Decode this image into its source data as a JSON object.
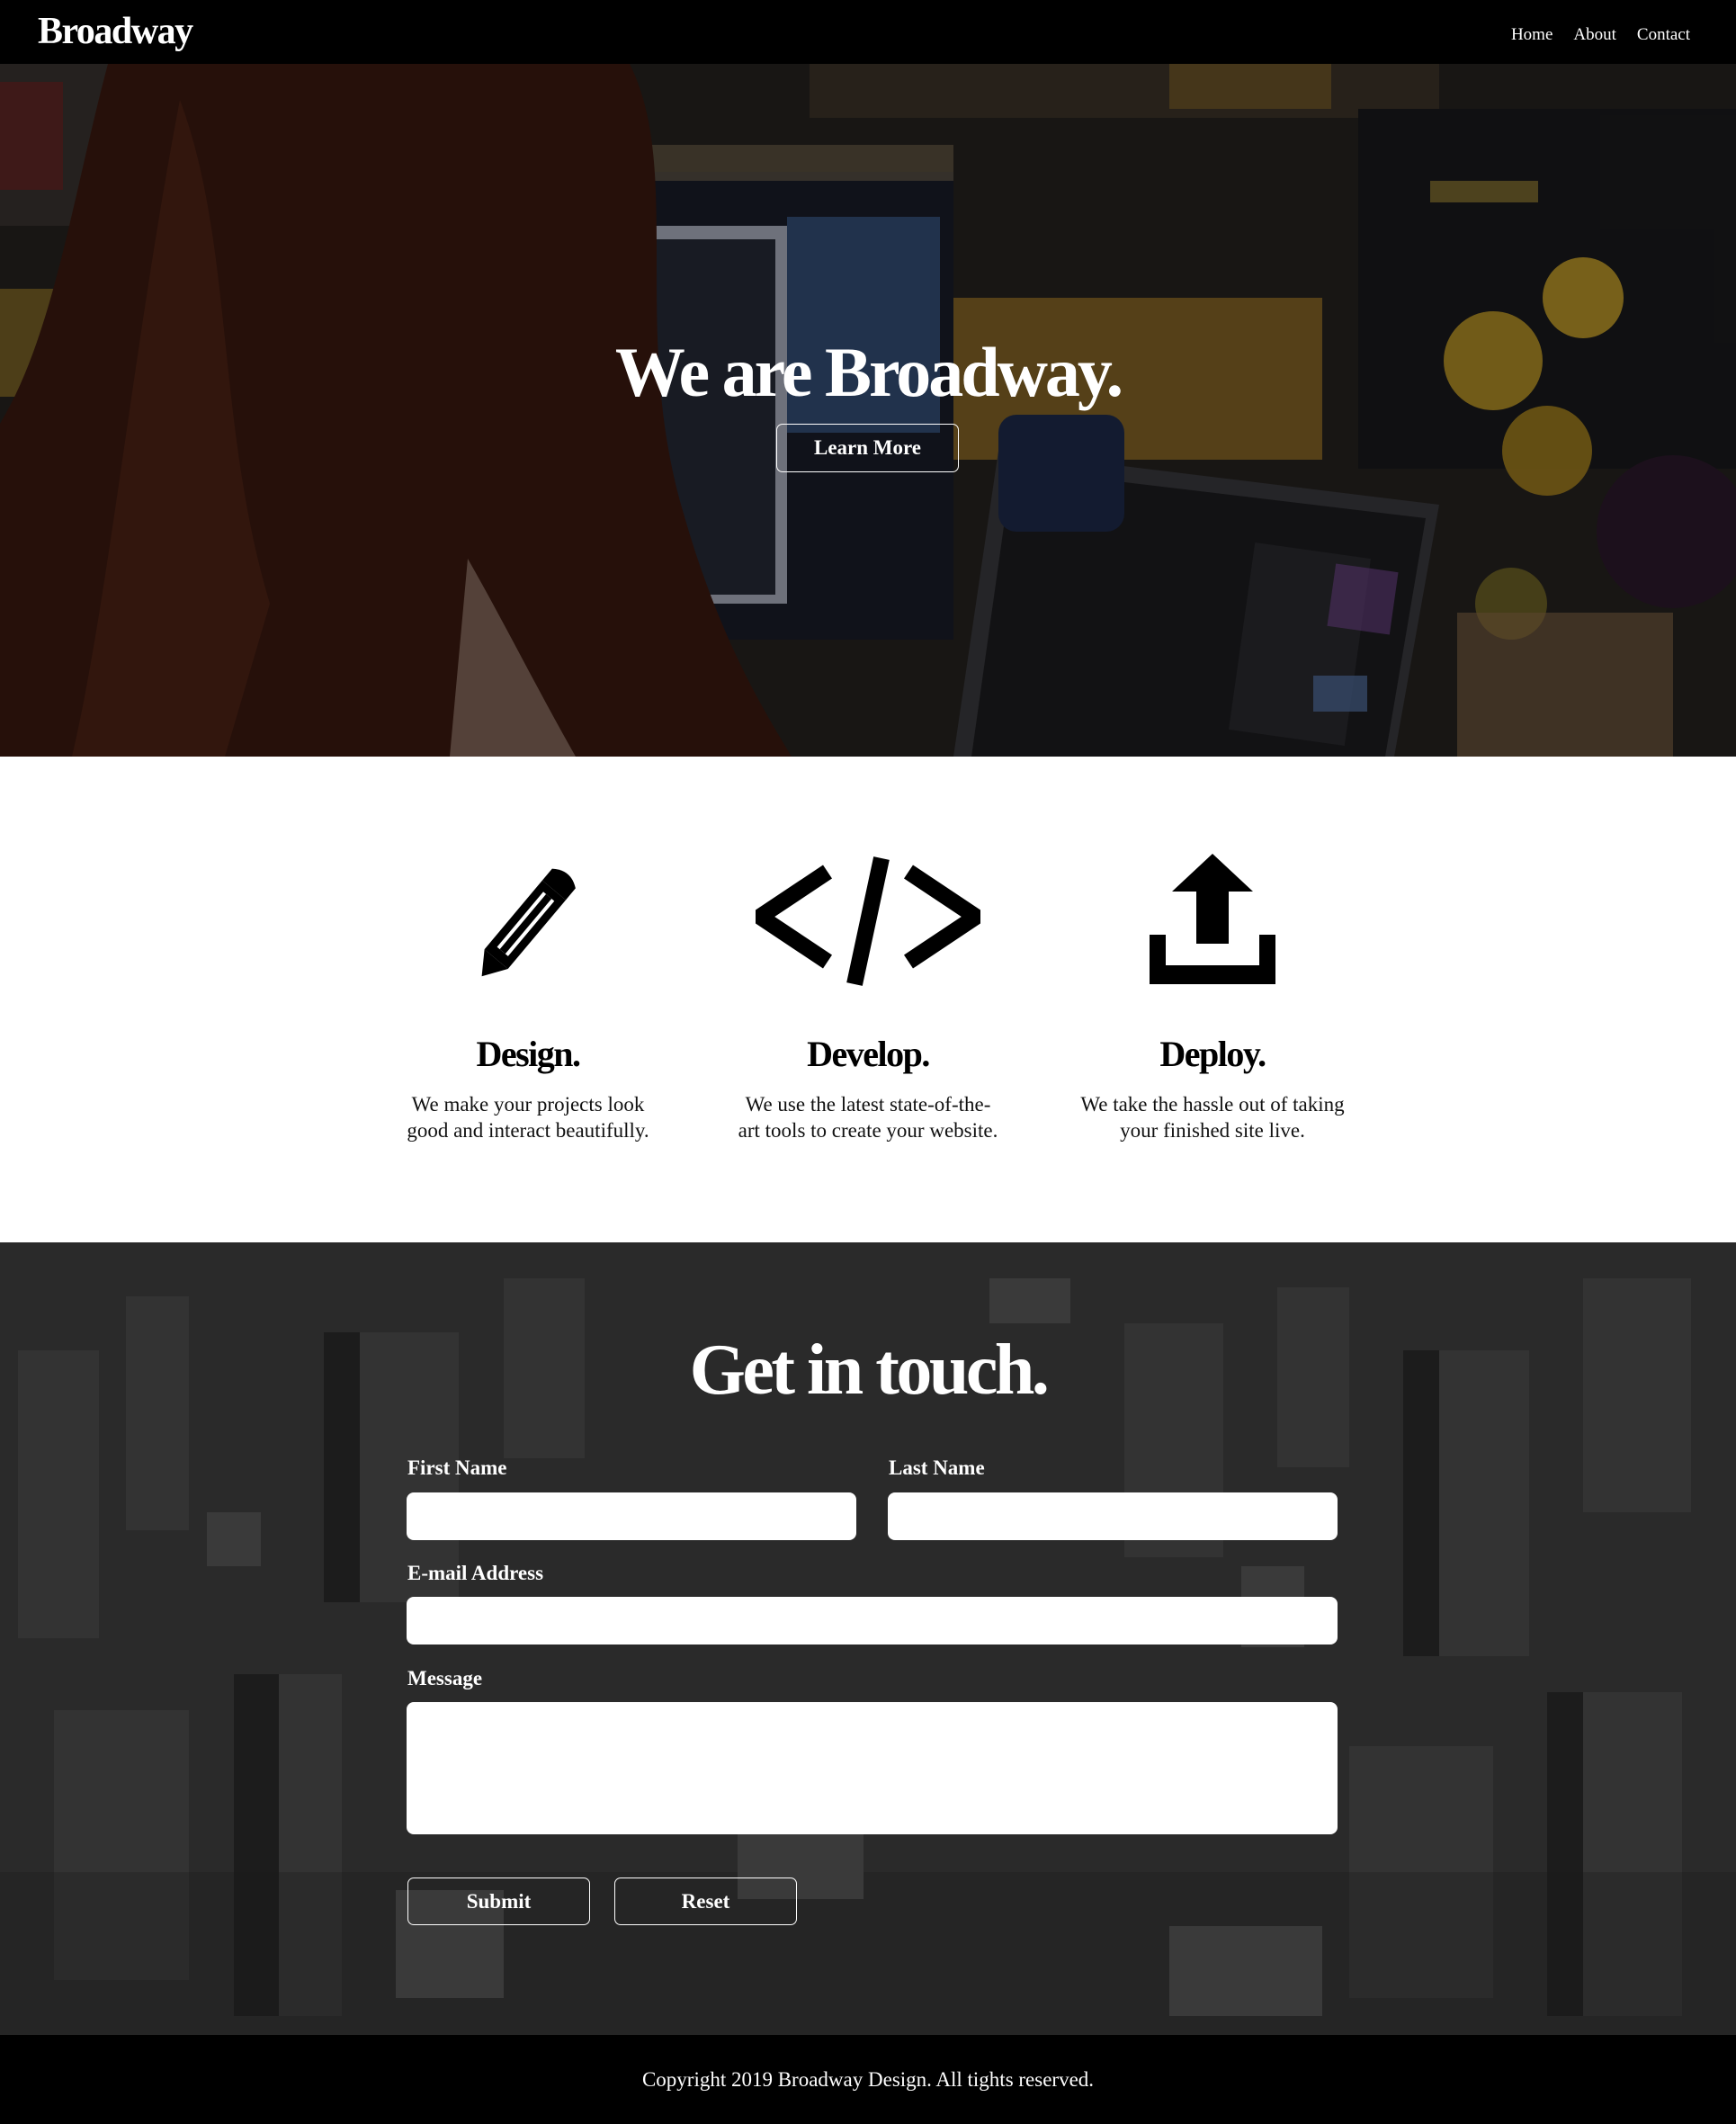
{
  "nav": {
    "brand": "Broadway",
    "links": [
      "Home",
      "About",
      "Contact"
    ]
  },
  "hero": {
    "title": "We are Broadway.",
    "button": "Learn More"
  },
  "features": [
    {
      "icon": "pencil-icon",
      "title": "Design.",
      "text": "We make your projects look good and interact beautifully."
    },
    {
      "icon": "code-icon",
      "title": "Develop.",
      "text": "We use the latest state-of-the-art tools to create your website."
    },
    {
      "icon": "upload-icon",
      "title": "Deploy.",
      "text": "We take the hassle out of taking your finished site live."
    }
  ],
  "contact": {
    "title": "Get in touch.",
    "first_name_label": "First Name",
    "last_name_label": "Last Name",
    "email_label": "E-mail Address",
    "message_label": "Message",
    "submit": "Submit",
    "reset": "Reset"
  },
  "footer": {
    "copyright": "Copyright 2019 Broadway Design. All tights reserved."
  },
  "colors": {
    "nav_bg": "#000000",
    "overlay": "#000000",
    "text_light": "#ffffff"
  }
}
